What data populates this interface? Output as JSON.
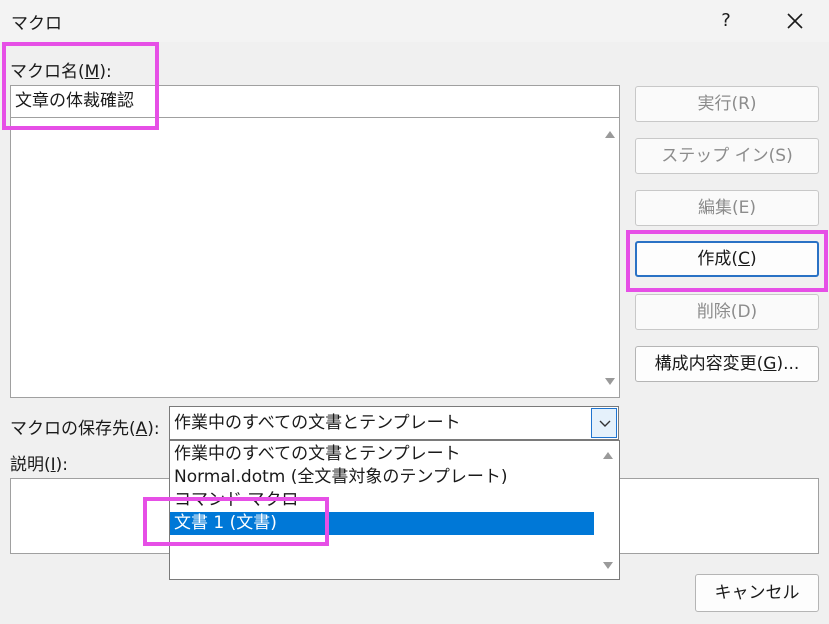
{
  "window": {
    "title": "マクロ",
    "help": "?",
    "close_icon": "close-icon"
  },
  "macro_name": {
    "label_prefix": "マクロ名(",
    "label_key": "M",
    "label_suffix": "):",
    "value": "文章の体裁確認"
  },
  "buttons": {
    "run": "実行(R)",
    "step_in": "ステップ イン(S)",
    "edit": "編集(E)",
    "create_prefix": "作成(",
    "create_key": "C",
    "create_suffix": ")",
    "delete": "削除(D)",
    "organizer_prefix": "構成内容変更(",
    "organizer_key": "G",
    "organizer_suffix": ")...",
    "cancel": "キャンセル"
  },
  "save_in": {
    "label_prefix": "マクロの保存先(",
    "label_key": "A",
    "label_suffix": "):",
    "value": "作業中のすべての文書とテンプレート"
  },
  "description": {
    "label_prefix": "説明(",
    "label_key": "I",
    "label_suffix": "):"
  },
  "dropdown_options": [
    "作業中のすべての文書とテンプレート",
    "Normal.dotm (全文書対象のテンプレート)",
    "コマンド マクロ",
    "文書 1 (文書)"
  ],
  "selected_option": "文書 1 (文書)",
  "colors": {
    "highlight": "#e64fe6",
    "selection": "#0078d7",
    "default_button_border": "#2a72c5"
  }
}
